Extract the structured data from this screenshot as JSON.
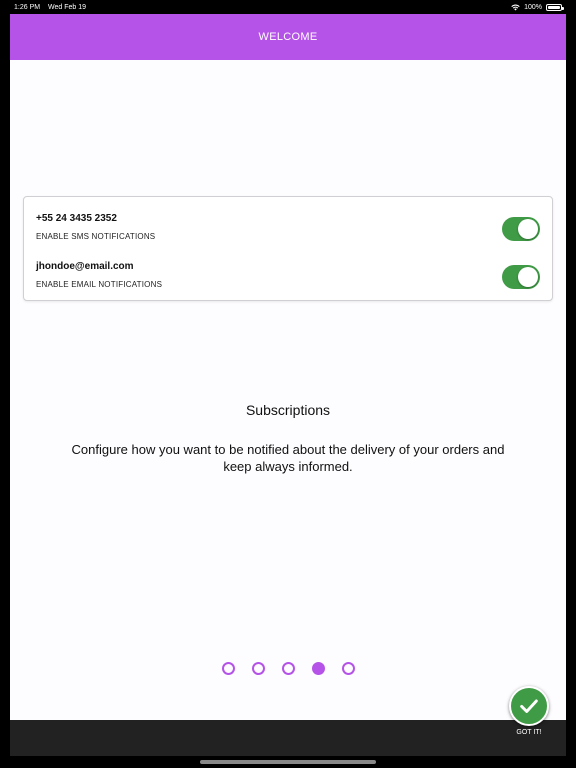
{
  "status_bar": {
    "time": "1:26 PM",
    "date": "Wed Feb 19",
    "battery": "100%",
    "icons": [
      "wifi-icon",
      "battery-icon"
    ]
  },
  "header": {
    "title": "WELCOME"
  },
  "notifications": {
    "items": [
      {
        "title": "+55 24 3435 2352",
        "label": "ENABLE SMS NOTIFICATIONS",
        "enabled": true
      },
      {
        "title": "jhondoe@email.com",
        "label": "ENABLE EMAIL NOTIFICATIONS",
        "enabled": true
      }
    ]
  },
  "content": {
    "title": "Subscriptions",
    "description": "Configure how you want to be notified about the delivery of your orders and keep always informed."
  },
  "pager": {
    "count": 5,
    "active_index": 3
  },
  "actions": {
    "got_it_label": "GOT IT!"
  },
  "colors": {
    "accent": "#b553e8",
    "toggle_on": "#3f9b45",
    "bottom_bar": "#222222"
  }
}
